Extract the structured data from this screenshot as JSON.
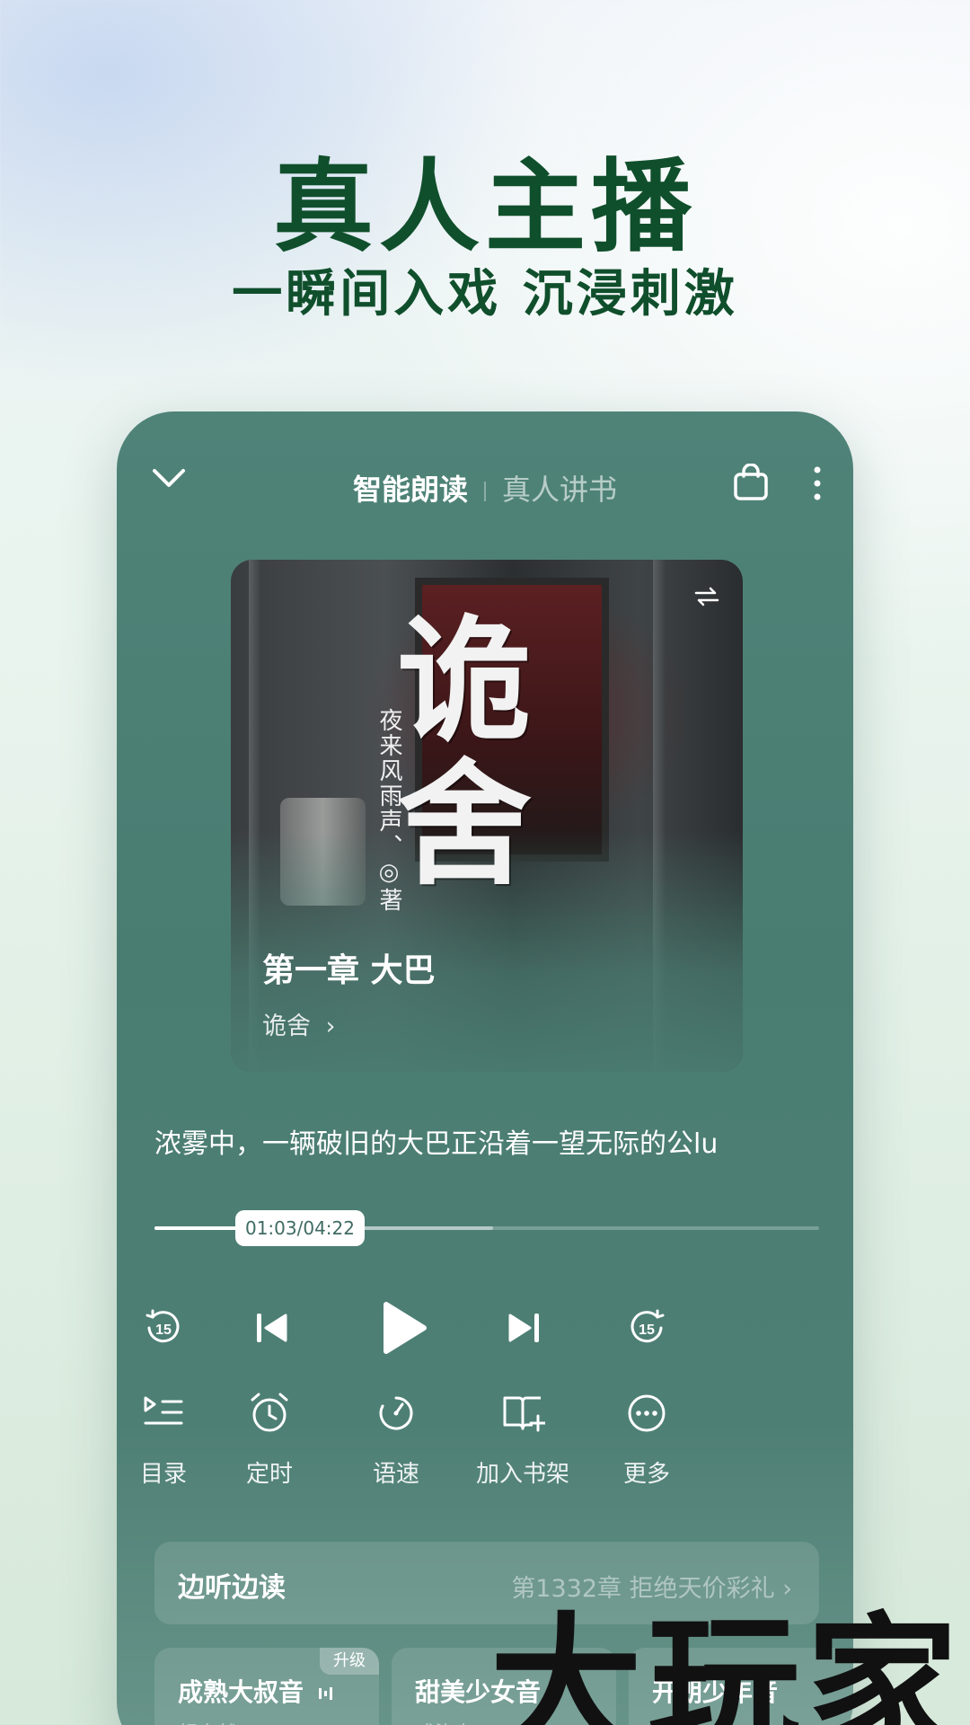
{
  "hero": {
    "title": "真人主播",
    "subtitle": "一瞬间入戏 沉浸刺激"
  },
  "player": {
    "tabs": [
      {
        "label": "智能朗读",
        "active": true
      },
      {
        "label": "真人讲书",
        "active": false
      }
    ],
    "icons": {
      "collapse": "chevron-down-icon",
      "cart": "shopping-bag-icon",
      "more": "more-vertical-icon",
      "switch": "switch-arrows-icon"
    },
    "cover": {
      "art_title": "诡舍",
      "art_author": "夜来风雨声、◎著",
      "chapter": "第一章 大巴",
      "book": "诡舍",
      "book_arrow": "›"
    },
    "excerpt": "浓雾中，一辆破旧的大巴正沿着一望无际的公lu",
    "progress": {
      "time": "01:03/04:22",
      "played_fraction": 0.24,
      "buffered_fraction": 0.51
    },
    "controls": [
      {
        "name": "rewind-15-button",
        "icon": "rewind-15-icon"
      },
      {
        "name": "previous-button",
        "icon": "skip-previous-icon"
      },
      {
        "name": "play-button",
        "icon": "play-icon"
      },
      {
        "name": "next-button",
        "icon": "skip-next-icon"
      },
      {
        "name": "forward-15-button",
        "icon": "forward-15-icon"
      }
    ],
    "functions": [
      {
        "label": "目录",
        "icon": "catalog-icon"
      },
      {
        "label": "定时",
        "icon": "alarm-clock-icon"
      },
      {
        "label": "语速",
        "icon": "speed-dial-icon"
      },
      {
        "label": "加入书架",
        "icon": "add-bookshelf-icon"
      },
      {
        "label": "更多",
        "icon": "more-circle-icon"
      }
    ],
    "listen_read": {
      "label": "边听边读",
      "chapter": "第1332章 拒绝天价彩礼 ›"
    },
    "voices": [
      {
        "name": "成熟大叔音",
        "desc": "超自然",
        "badge": "升级",
        "playing": true
      },
      {
        "name": "甜美少女音",
        "desc": "感染力"
      },
      {
        "name": "开朗少年音",
        "desc": "轻快"
      }
    ]
  },
  "watermark": "大玩家",
  "colors": {
    "title_green": "#104f2c",
    "panel": "#4a7d72",
    "time_text": "#3f6b62"
  }
}
